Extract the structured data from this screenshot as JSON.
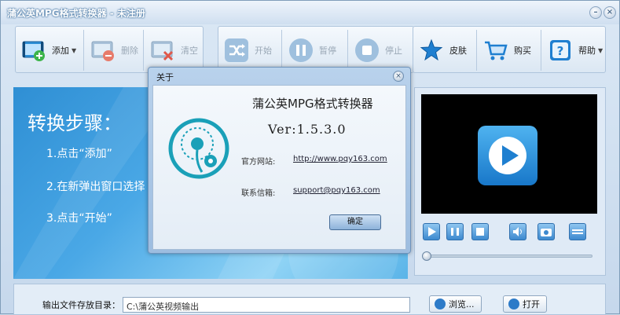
{
  "window": {
    "title": "蒲公英MPG格式转换器 - 未注册"
  },
  "toolbar": {
    "add": "添加",
    "delete": "删除",
    "clear": "清空",
    "start": "开始",
    "pause": "暂停",
    "stop": "停止",
    "skin": "皮肤",
    "buy": "购买",
    "help": "帮助"
  },
  "steps": {
    "title": "转换步骤：",
    "step1": "1.点击“添加”",
    "step2": "2.在新弹出窗口选择",
    "step3": "3.点击“开始”"
  },
  "about": {
    "title": "关于",
    "app_name": "蒲公英MPG格式转换器",
    "version": "Ver:1.5.3.0",
    "website_label": "官方网站:",
    "website": "http://www.pqy163.com",
    "email_label": "联系信箱:",
    "email": "support@pqy163.com",
    "ok": "确定"
  },
  "output": {
    "label": "输出文件存放目录：",
    "path": "C:\\蒲公英视频输出",
    "browse": "浏览...",
    "open": "打开"
  },
  "colors": {
    "accent": "#2d7bc8",
    "panel_blue": "#4aa8e6",
    "video_bg": "#000000"
  }
}
